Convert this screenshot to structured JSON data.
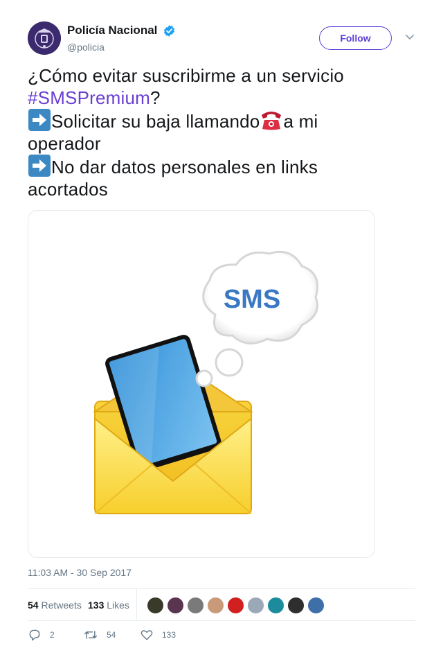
{
  "author": {
    "name": "Policía Nacional",
    "handle": "@policia",
    "verified": true
  },
  "follow_button": {
    "label": "Follow",
    "color": "#5b3dd8"
  },
  "tweet": {
    "line1": "¿Cómo evitar suscribirme a un servicio",
    "hashtag": "#SMSPremium",
    "after_hashtag": "?",
    "line3_a": "Solicitar su baja llamando",
    "line3_b": "a mi",
    "line4": "operador",
    "line5": "No dar datos personales en links",
    "line6": "acortados"
  },
  "media": {
    "bubble_text": "SMS"
  },
  "timestamp": "11:03 AM - 30 Sep 2017",
  "stats": {
    "retweets_count": "54",
    "retweets_label": "Retweets",
    "likes_count": "133",
    "likes_label": "Likes"
  },
  "liker_colors": [
    "#3a3a2a",
    "#5a3550",
    "#7a7a7a",
    "#c99a7a",
    "#d22020",
    "#9aa8b8",
    "#1c8c9c",
    "#2e2e2e",
    "#3f6fa8"
  ],
  "actions": {
    "reply_count": "2",
    "retweet_count": "54",
    "like_count": "133"
  },
  "icons": [
    "verified-badge-icon",
    "chevron-down-icon",
    "arrow-right-emoji-icon",
    "telephone-emoji-icon",
    "reply-icon",
    "retweet-icon",
    "heart-icon"
  ]
}
